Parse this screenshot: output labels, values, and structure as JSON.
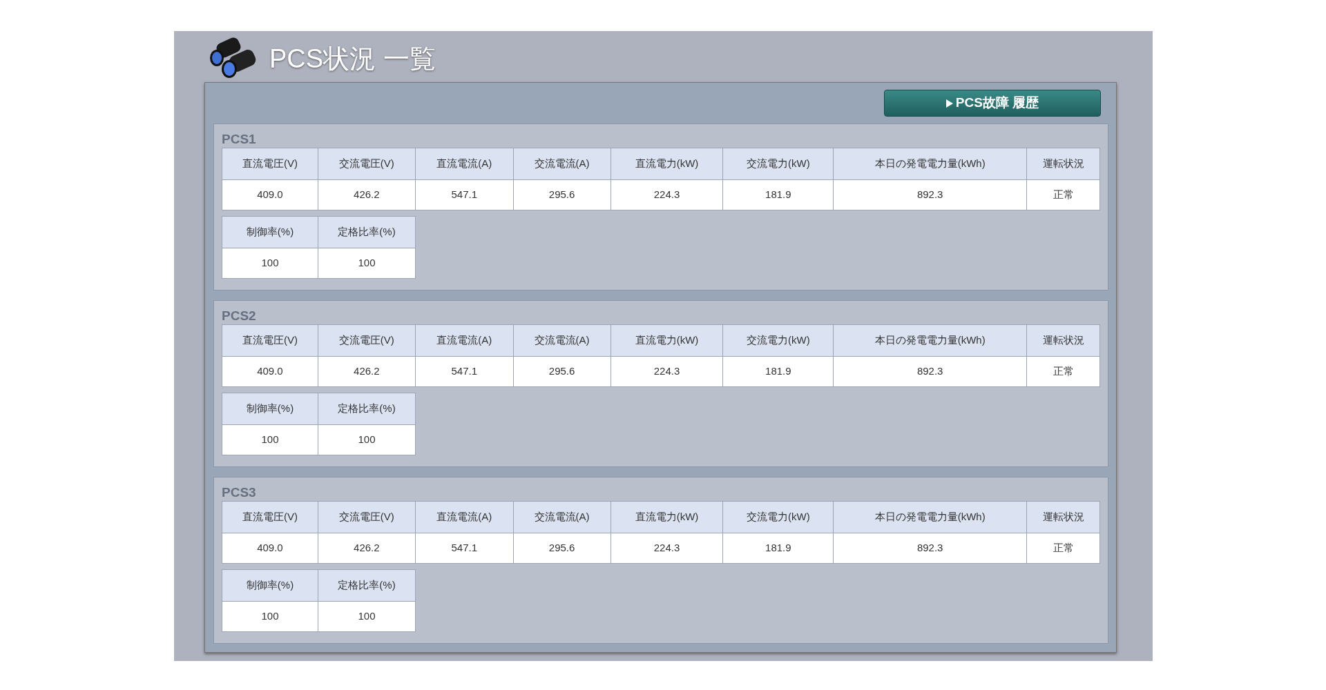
{
  "page": {
    "title": "PCS状況 一覧"
  },
  "history_button": {
    "label": "PCS故障 履歴"
  },
  "units": [
    {
      "name": "PCS1",
      "columns": [
        "直流電圧(V)",
        "交流電圧(V)",
        "直流電流(A)",
        "交流電流(A)",
        "直流電力(kW)",
        "交流電力(kW)",
        "本日の発電電力量(kWh)",
        "運転状況"
      ],
      "values": [
        "409.0",
        "426.2",
        "547.1",
        "295.6",
        "224.3",
        "181.9",
        "892.3",
        "正常"
      ],
      "extra_columns": [
        "制御率(%)",
        "定格比率(%)"
      ],
      "extra_values": [
        "100",
        "100"
      ]
    },
    {
      "name": "PCS2",
      "columns": [
        "直流電圧(V)",
        "交流電圧(V)",
        "直流電流(A)",
        "交流電流(A)",
        "直流電力(kW)",
        "交流電力(kW)",
        "本日の発電電力量(kWh)",
        "運転状況"
      ],
      "values": [
        "409.0",
        "426.2",
        "547.1",
        "295.6",
        "224.3",
        "181.9",
        "892.3",
        "正常"
      ],
      "extra_columns": [
        "制御率(%)",
        "定格比率(%)"
      ],
      "extra_values": [
        "100",
        "100"
      ]
    },
    {
      "name": "PCS3",
      "columns": [
        "直流電圧(V)",
        "交流電圧(V)",
        "直流電流(A)",
        "交流電流(A)",
        "直流電力(kW)",
        "交流電力(kW)",
        "本日の発電電力量(kWh)",
        "運転状況"
      ],
      "values": [
        "409.0",
        "426.2",
        "547.1",
        "295.6",
        "224.3",
        "181.9",
        "892.3",
        "正常"
      ],
      "extra_columns": [
        "制御率(%)",
        "定格比率(%)"
      ],
      "extra_values": [
        "100",
        "100"
      ]
    }
  ]
}
